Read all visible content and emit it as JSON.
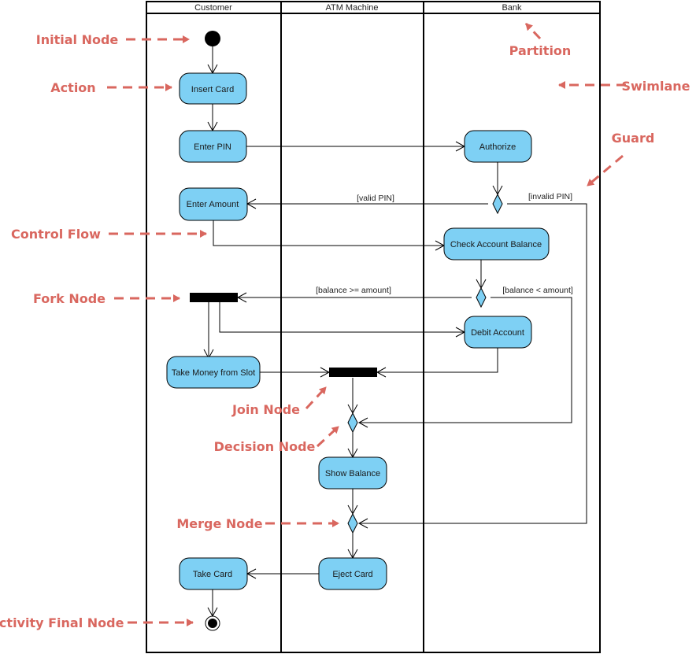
{
  "diagram": {
    "type": "UML Activity Diagram",
    "colors": {
      "action_fill": "#7ed0f4",
      "annotation": "#d9675f",
      "line": "#000000"
    },
    "swimlanes": [
      {
        "id": "customer",
        "title": "Customer"
      },
      {
        "id": "atm",
        "title": "ATM Machine"
      },
      {
        "id": "bank",
        "title": "Bank"
      }
    ],
    "actions": {
      "insert_card": "Insert Card",
      "enter_pin": "Enter PIN",
      "authorize": "Authorize",
      "enter_amount": "Enter Amount",
      "check_balance": "Check Account Balance",
      "debit_account": "Debit Account",
      "take_money": "Take Money from Slot",
      "show_balance": "Show Balance",
      "eject_card": "Eject Card",
      "take_card": "Take Card"
    },
    "guards": {
      "valid_pin": "[valid PIN]",
      "invalid_pin": "[invalid PIN]",
      "balance_ge": "[balance >= amount]",
      "balance_lt": "[balance < amount]"
    },
    "annotations": {
      "initial_node": "Initial Node",
      "action": "Action",
      "control_flow": "Control Flow",
      "fork_node": "Fork Node",
      "join_node": "Join Node",
      "decision_node": "Decision Node",
      "merge_node": "Merge Node",
      "activity_final_node": "Activity Final Node",
      "partition": "Partition",
      "swimlane": "Swimlane",
      "guard": "Guard"
    }
  }
}
